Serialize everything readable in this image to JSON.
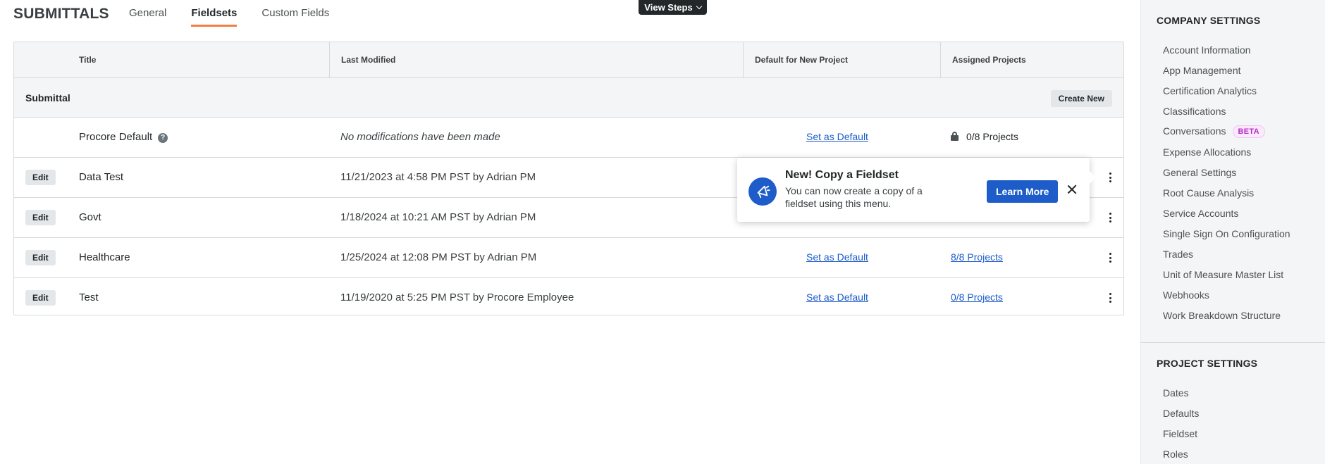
{
  "header": {
    "title": "SUBMITTALS",
    "tabs": [
      {
        "label": "General",
        "active": false
      },
      {
        "label": "Fieldsets",
        "active": true
      },
      {
        "label": "Custom Fields",
        "active": false
      }
    ],
    "view_steps_label": "View Steps"
  },
  "table": {
    "columns": {
      "title": "Title",
      "last_modified": "Last Modified",
      "default_for_new_project": "Default for New Project",
      "assigned_projects": "Assigned Projects"
    },
    "group": {
      "title": "Submittal",
      "create_new_label": "Create New"
    },
    "edit_label": "Edit",
    "rows": [
      {
        "title": "Procore Default",
        "last_modified": "No modifications have been made",
        "default_action": "Set as Default",
        "assigned": "0/8 Projects"
      },
      {
        "title": "Data Test",
        "last_modified": "11/21/2023 at 4:58 PM PST by Adrian PM",
        "default_action": "",
        "assigned": ""
      },
      {
        "title": "Govt",
        "last_modified": "1/18/2024 at 10:21 AM PST by Adrian PM",
        "default_action": "",
        "assigned": ""
      },
      {
        "title": "Healthcare",
        "last_modified": "1/25/2024 at 12:08 PM PST by Adrian PM",
        "default_action": "Set as Default",
        "assigned": "8/8 Projects"
      },
      {
        "title": "Test",
        "last_modified": "11/19/2020 at 5:25 PM PST by Procore Employee",
        "default_action": "Set as Default",
        "assigned": "0/8 Projects"
      }
    ]
  },
  "popover": {
    "title": "New! Copy a Fieldset",
    "body": "You can now create a copy of a fieldset using this menu.",
    "learn_more_label": "Learn More"
  },
  "settings": {
    "company_heading": "COMPANY SETTINGS",
    "company_items": [
      "Account Information",
      "App Management",
      "Certification Analytics",
      "Classifications",
      "Conversations",
      "Expense Allocations",
      "General Settings",
      "Root Cause Analysis",
      "Service Accounts",
      "Single Sign On Configuration",
      "Trades",
      "Unit of Measure Master List",
      "Webhooks",
      "Work Breakdown Structure"
    ],
    "beta_label": "BETA",
    "project_heading": "PROJECT SETTINGS",
    "project_items": [
      "Dates",
      "Defaults",
      "Fieldset",
      "Roles"
    ]
  },
  "colors": {
    "accent_tab": "#f47e42",
    "primary_blue": "#1d5cc9",
    "link": "#1d5cc9",
    "beta_text": "#b42cc6"
  },
  "icons": {
    "help": "help-circle-icon",
    "lock": "lock-icon",
    "popover": "megaphone-icon",
    "kebab": "kebab-menu-icon",
    "close": "close-icon",
    "dropdown": "chevron-down-icon"
  }
}
